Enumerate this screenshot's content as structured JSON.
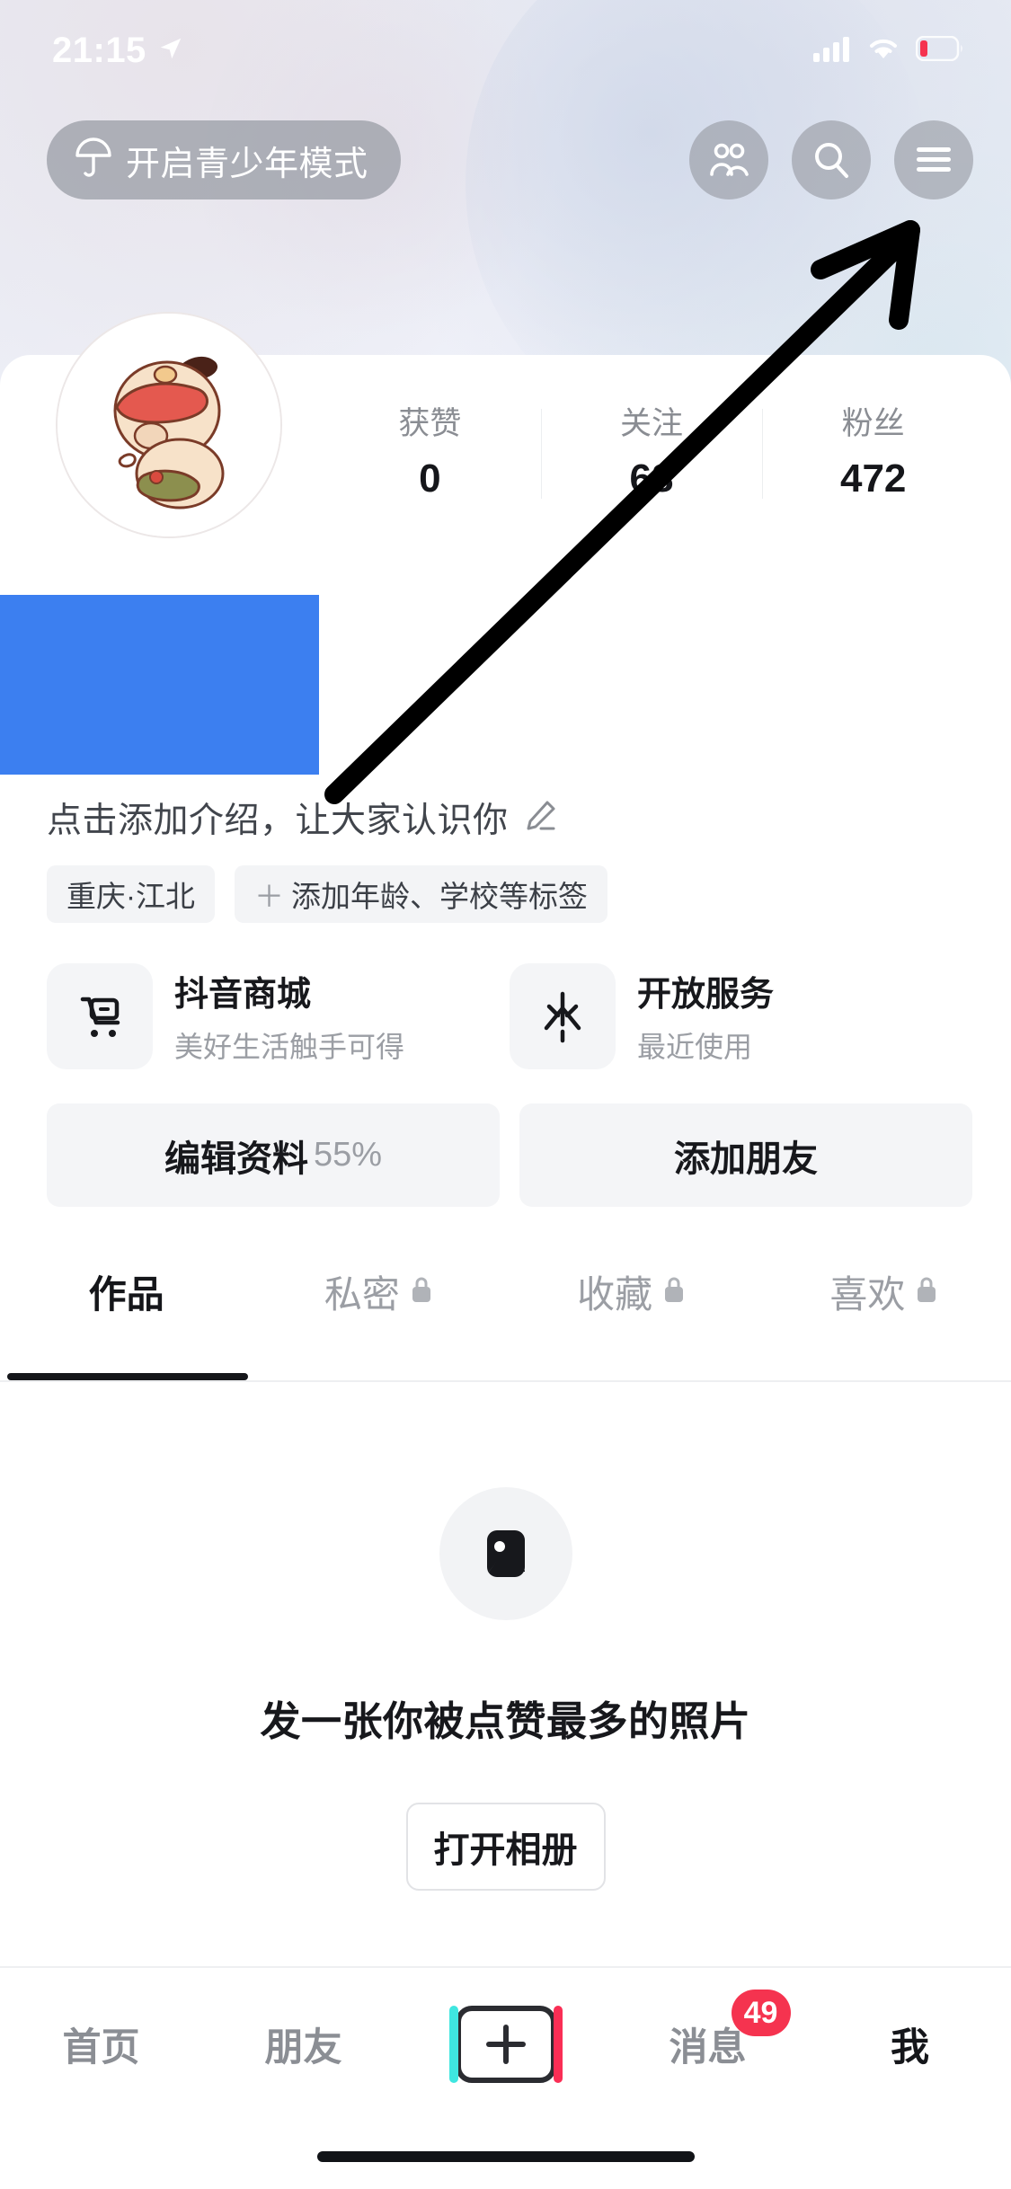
{
  "status_bar": {
    "time": "21:15",
    "location_icon": "location-arrow-icon",
    "signal_icon": "cellular-signal-icon",
    "wifi_icon": "wifi-icon",
    "battery_icon": "battery-low-icon"
  },
  "header": {
    "teen_mode_label": "开启青少年模式",
    "teen_mode_icon": "umbrella-shield-icon",
    "icons": [
      {
        "name": "friends-icon"
      },
      {
        "name": "search-icon"
      },
      {
        "name": "hamburger-menu-icon"
      }
    ]
  },
  "profile": {
    "avatar_alt": "cartoon-baby-avatar",
    "username_redacted": true,
    "redaction_color": "#3c7ff0",
    "stats": [
      {
        "label": "获赞",
        "value": "0"
      },
      {
        "label": "关注",
        "value": "68"
      },
      {
        "label": "粉丝",
        "value": "472"
      }
    ],
    "bio_placeholder": "点击添加介绍，让大家认识你",
    "bio_edit_icon": "pencil-edit-icon",
    "tags": [
      {
        "label": "重庆·江北",
        "has_plus": false
      },
      {
        "label": "添加年龄、学校等标签",
        "has_plus": true,
        "plus": "＋"
      }
    ]
  },
  "services": [
    {
      "title": "抖音商城",
      "subtitle": "美好生活触手可得",
      "icon": "shopping-cart-icon"
    },
    {
      "title": "开放服务",
      "subtitle": "最近使用",
      "icon": "douyin-open-service-icon"
    }
  ],
  "actions": [
    {
      "label": "编辑资料",
      "suffix": "55%"
    },
    {
      "label": "添加朋友",
      "suffix": ""
    }
  ],
  "tabs": [
    {
      "label": "作品",
      "locked": false,
      "active": true
    },
    {
      "label": "私密",
      "locked": true,
      "active": false
    },
    {
      "label": "收藏",
      "locked": true,
      "active": false
    },
    {
      "label": "喜欢",
      "locked": true,
      "active": false
    }
  ],
  "empty_state": {
    "icon": "photo-placeholder-icon",
    "text": "发一张你被点赞最多的照片",
    "button_label": "打开相册"
  },
  "bottom_nav": {
    "items": [
      {
        "label": "首页",
        "active": false
      },
      {
        "label": "朋友",
        "active": false
      },
      {
        "label": "",
        "type": "create",
        "icon": "plus-create-icon"
      },
      {
        "label": "消息",
        "active": false,
        "badge": "49"
      },
      {
        "label": "我",
        "active": true
      }
    ]
  },
  "annotation": {
    "arrow_name": "annotation-arrow-to-menu",
    "color": "#000000"
  }
}
